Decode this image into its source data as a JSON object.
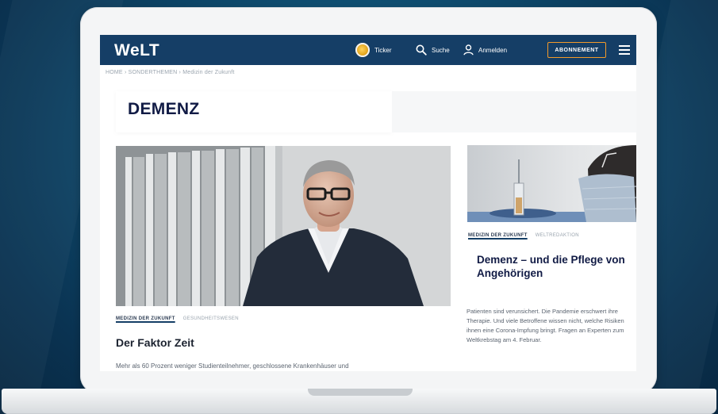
{
  "site": {
    "logo": "WeLT"
  },
  "nav": {
    "ticker_label": "Ticker",
    "search_label": "Suche",
    "login_label": "Anmelden",
    "abo_label": "ABONNEMENT"
  },
  "breadcrumb": "HOME  ›  SONDERTHEMEN  ›  Medizin der Zukunft",
  "page": {
    "title": "DEMENZ"
  },
  "main_article": {
    "tags": [
      "MEDIZIN DER ZUKUNFT",
      "GESUNDHEITSWESEN"
    ],
    "headline": "Der Faktor Zeit",
    "teaser": "Mehr als 60 Prozent weniger Studienteilnehmer, geschlossene Krankenhäuser und"
  },
  "side_article": {
    "tags": [
      "MEDIZIN DER ZUKUNFT",
      "WELTREDAKTION"
    ],
    "headline": "Demenz – und die Pflege von Angehörigen",
    "teaser": "Patienten sind verunsichert. Die Pandemie erschwert ihre Therapie. Und viele Betroffene wissen nicht, welche Risiken ihnen eine Corona-Impfung bringt. Fragen an Experten zum Weltkrebstag am 4. Februar."
  },
  "colors": {
    "header": "#153e66",
    "abo_border": "#f39a2a",
    "title": "#111b45",
    "background": "#0f4d70"
  }
}
